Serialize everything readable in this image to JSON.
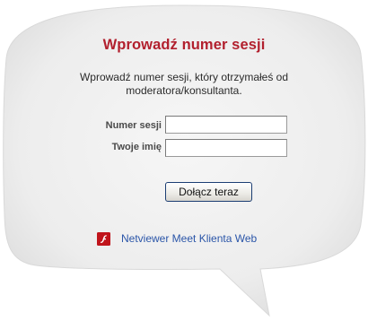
{
  "dialog": {
    "title": "Wprowadź numer sesji",
    "instructions": "Wprowadź numer sesji, który otrzymałeś od moderatora/konsultanta.",
    "session_label": "Numer sesji",
    "session_value": "",
    "name_label": "Twoje imię",
    "name_value": "",
    "join_button_label": "Dołącz teraz",
    "web_client_link": "Netviewer Meet Klienta Web",
    "web_client_icon": "flash-icon"
  },
  "colors": {
    "title": "#b2202e",
    "link": "#2a55a8",
    "bubble": "#f0f0f0"
  }
}
